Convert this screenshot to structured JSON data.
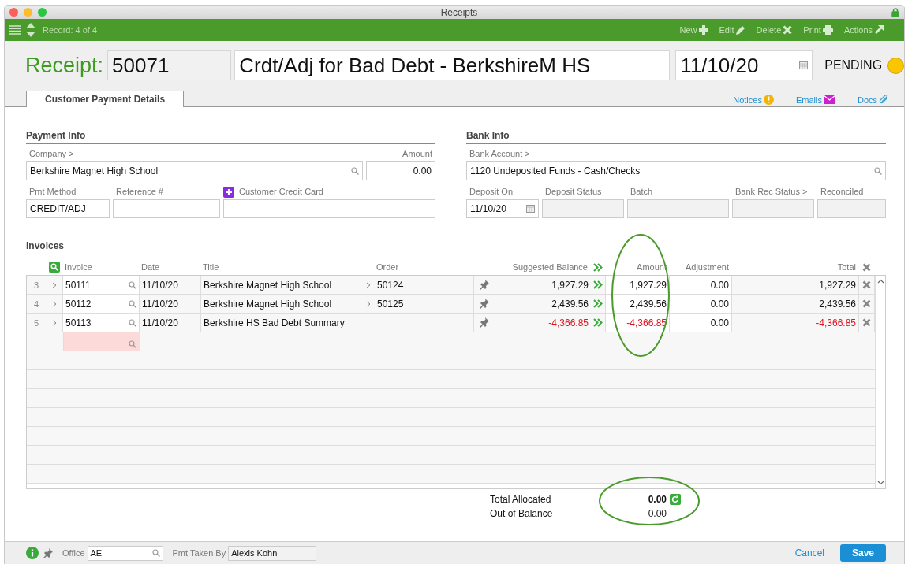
{
  "window": {
    "title": "Receipts"
  },
  "toolbar": {
    "record": "Record: 4 of 4",
    "actions": [
      {
        "label": "New"
      },
      {
        "label": "Edit"
      },
      {
        "label": "Delete"
      },
      {
        "label": "Print"
      },
      {
        "label": "Actions"
      }
    ]
  },
  "header": {
    "label": "Receipt:",
    "number": "50071",
    "title": "Crdt/Adj for Bad Debt - BerkshireM HS",
    "date": "11/10/20",
    "status": "PENDING"
  },
  "tabs": [
    {
      "label": "Customer Payment Details",
      "selected": true
    }
  ],
  "links": [
    {
      "label": "Notices"
    },
    {
      "label": "Emails"
    },
    {
      "label": "Docs"
    }
  ],
  "payment_info": {
    "heading": "Payment Info",
    "company_label": "Company >",
    "company": "Berkshire Magnet High School",
    "amount_label": "Amount",
    "amount": "0.00",
    "pmt_method_label": "Pmt Method",
    "pmt_method": "CREDIT/ADJ",
    "reference_label": "Reference #",
    "credit_card_label": "Customer Credit Card"
  },
  "bank_info": {
    "heading": "Bank Info",
    "account_label": "Bank Account >",
    "account": "1120 Undeposited Funds - Cash/Checks",
    "fields": [
      {
        "label": "Deposit On",
        "value": "11/10/20",
        "kind": "date"
      },
      {
        "label": "Deposit Status",
        "kind": "readonly"
      },
      {
        "label": "Batch",
        "kind": "readonly"
      },
      {
        "label": "Bank Rec Status >",
        "kind": "readonly"
      },
      {
        "label": "Reconciled",
        "kind": "readonly"
      }
    ]
  },
  "invoices": {
    "heading": "Invoices",
    "columns": [
      "Invoice",
      "Date",
      "Title",
      "Order",
      "Suggested Balance",
      "Amount",
      "Adjustment",
      "Total"
    ],
    "rows": [
      {
        "line": "3",
        "invoice": "50111",
        "date": "11/10/20",
        "title": "Berkshire Magnet High School",
        "order": "50124",
        "suggested": "1,927.29",
        "amount": "1,927.29",
        "adjustment": "0.00",
        "total": "1,927.29",
        "negative": false
      },
      {
        "line": "4",
        "invoice": "50112",
        "date": "11/10/20",
        "title": "Berkshire Magnet High School",
        "order": "50125",
        "suggested": "2,439.56",
        "amount": "2,439.56",
        "adjustment": "0.00",
        "total": "2,439.56",
        "negative": false
      },
      {
        "line": "5",
        "invoice": "50113",
        "date": "11/10/20",
        "title": "Berkshire HS Bad Debt Summary",
        "suggested": "-4,366.85",
        "amount": "-4,366.85",
        "adjustment": "0.00",
        "total": "-4,366.85",
        "negative": true
      }
    ]
  },
  "totals": [
    {
      "label": "Total Allocated",
      "value": "0.00",
      "kind": "allocated"
    },
    {
      "label": "Out of Balance",
      "value": "0.00",
      "kind": "balance"
    }
  ],
  "footer": {
    "office_label": "Office",
    "office": "AE",
    "taken_by_label": "Pmt Taken By",
    "taken_by": "Alexis Kohn",
    "cancel": "Cancel",
    "save": "Save"
  }
}
